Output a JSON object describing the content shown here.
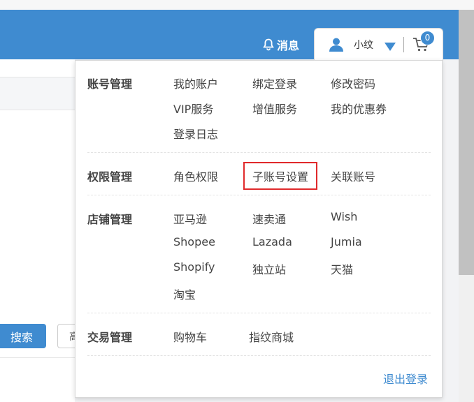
{
  "header": {
    "messages_label": "消息",
    "user_name": "小纹",
    "cart_count": "0"
  },
  "background": {
    "search_button": "搜索",
    "partial_button": "高"
  },
  "menu": {
    "account": {
      "title": "账号管理",
      "items": [
        "我的账户",
        "绑定登录",
        "修改密码",
        "VIP服务",
        "增值服务",
        "我的优惠券",
        "登录日志"
      ]
    },
    "permission": {
      "title": "权限管理",
      "items": [
        "角色权限",
        "子账号设置",
        "关联账号"
      ]
    },
    "store": {
      "title": "店铺管理",
      "items": [
        "亚马逊",
        "速卖通",
        "Wish",
        "Shopee",
        "Lazada",
        "Jumia",
        "Shopify",
        "独立站",
        "天猫",
        "淘宝"
      ]
    },
    "trade": {
      "title": "交易管理",
      "items": [
        "购物车",
        "指纹商城"
      ]
    },
    "logout": "退出登录"
  },
  "colors": {
    "brand_blue": "#3f8bd0",
    "highlight_red": "#e0292b"
  }
}
